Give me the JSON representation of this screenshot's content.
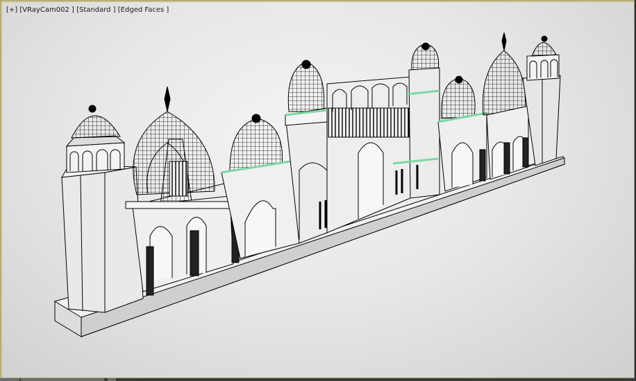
{
  "viewport": {
    "label_plus": "[+]",
    "label_camera": "[VRayCam002 ]",
    "label_shading": "[Standard ]",
    "label_edged": "[Edged Faces ]"
  },
  "colors": {
    "background": "#e6e6e6",
    "wire": "#000000",
    "surface": "#ececec",
    "selected_edge": "#7fd6a0",
    "viewport_border": "#c9c07a"
  }
}
